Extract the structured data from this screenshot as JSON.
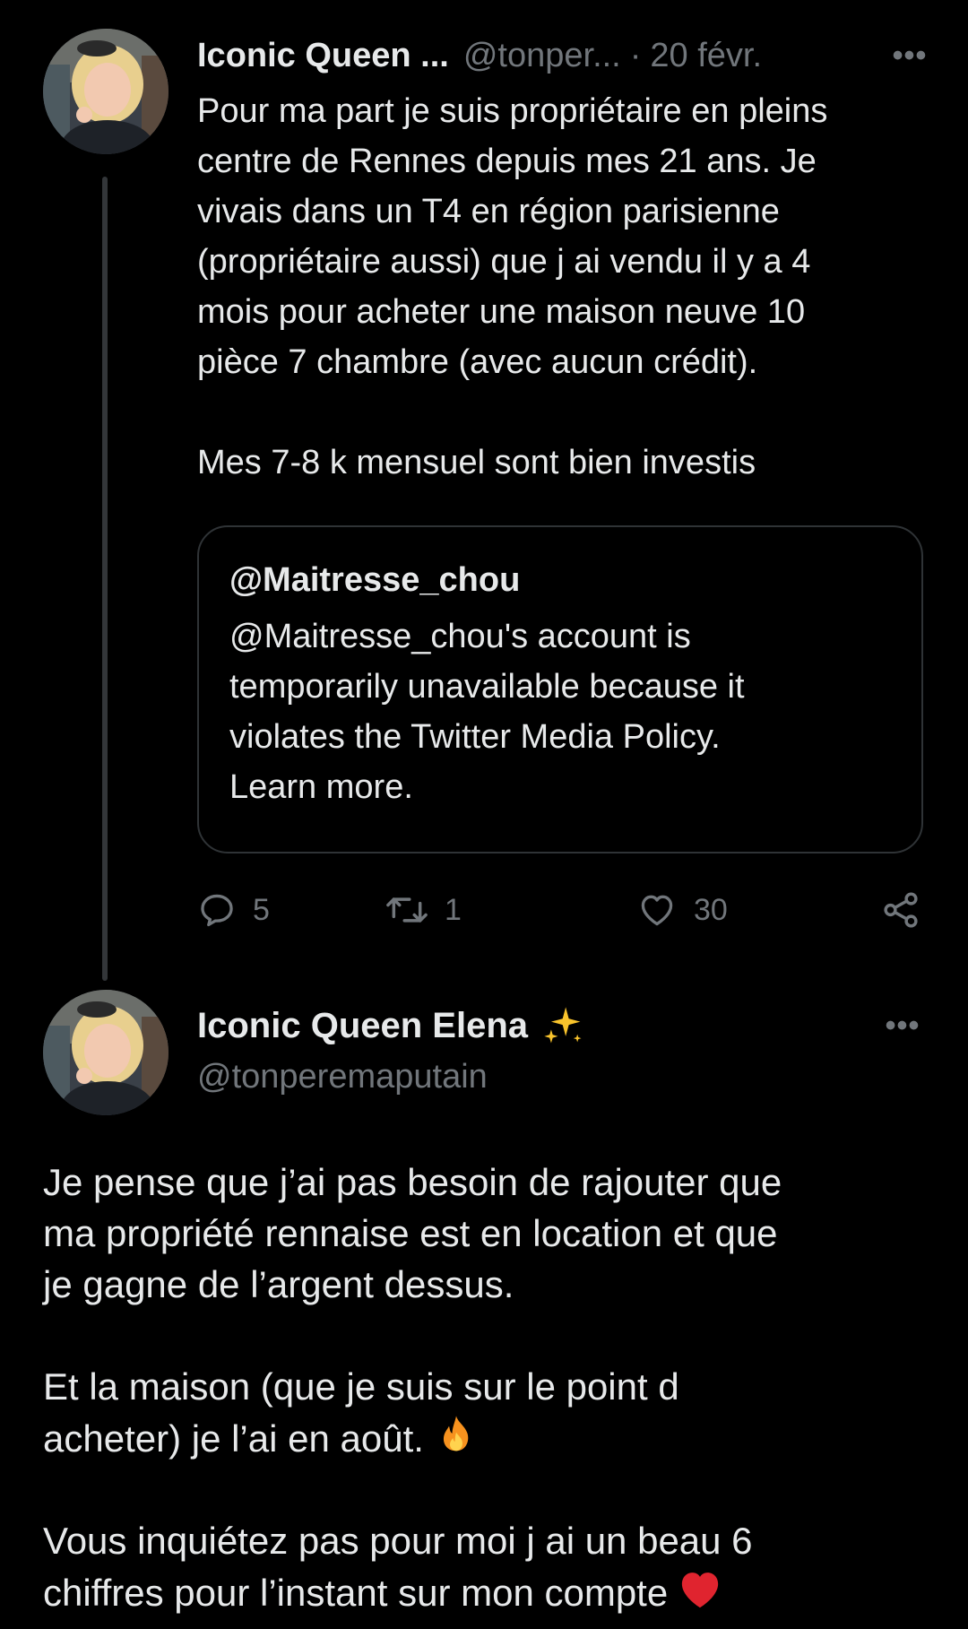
{
  "tweet1": {
    "display_name": "Iconic Queen ...",
    "handle": "@tonper...",
    "separator": "·",
    "date": "20 févr.",
    "more_label": "•••",
    "text_lines": [
      "Pour ma part je suis propriétaire en pleins",
      "centre de Rennes depuis mes 21 ans. Je",
      "vivais dans un T4 en région parisienne",
      "(propriétaire aussi) que j ai vendu il y a 4",
      "mois pour acheter une maison neuve 10",
      "pièce 7 chambre (avec aucun crédit).",
      "",
      "Mes 7-8 k mensuel sont bien investis"
    ],
    "quote": {
      "handle": "@Maitresse_chou",
      "message_lines": [
        "@Maitresse_chou's account is",
        "temporarily unavailable because it",
        "violates the Twitter Media Policy.",
        "Learn more."
      ]
    },
    "actions": {
      "replies": "5",
      "retweets": "1",
      "likes": "30",
      "reply_icon": "reply-icon",
      "retweet_icon": "retweet-icon",
      "like_icon": "heart-icon",
      "share_icon": "share-icon"
    }
  },
  "tweet2": {
    "display_name": "Iconic Queen Elena",
    "name_emoji": "sparkles-icon",
    "handle": "@tonperemaputain",
    "more_label": "•••",
    "paragraph1_lines": [
      "Je pense que j’ai pas besoin de rajouter que",
      "ma propriété rennaise est en location et que",
      "je gagne de l’argent dessus."
    ],
    "paragraph2_lines": [
      "Et la maison (que je suis sur le point d",
      "acheter) je l’ai en août."
    ],
    "paragraph2_emoji": "fire-icon",
    "paragraph3_lines": [
      "Vous inquiétez pas pour moi j ai un beau 6",
      "chiffres pour l’instant sur mon compte"
    ],
    "paragraph3_emoji": "red-heart-icon"
  },
  "colors": {
    "background": "#000000",
    "text": "#e7e9ea",
    "muted": "#71767b",
    "border": "#2f3336",
    "thread_line": "#333639"
  }
}
